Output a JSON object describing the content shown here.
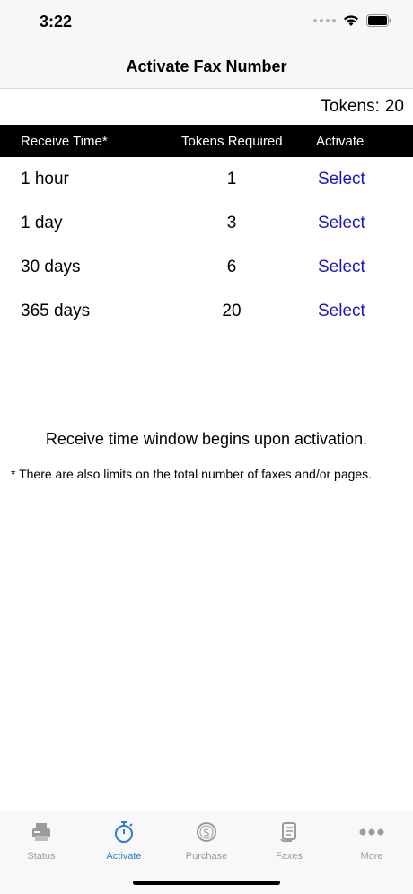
{
  "status_bar": {
    "time": "3:22"
  },
  "nav": {
    "title": "Activate Fax Number"
  },
  "tokens": {
    "label": "Tokens:",
    "value": "20"
  },
  "table": {
    "headers": {
      "receive_time": "Receive Time*",
      "tokens_required": "Tokens Required",
      "activate": "Activate"
    },
    "rows": [
      {
        "time": "1 hour",
        "tokens": "1",
        "action": "Select"
      },
      {
        "time": "1 day",
        "tokens": "3",
        "action": "Select"
      },
      {
        "time": "30 days",
        "tokens": "6",
        "action": "Select"
      },
      {
        "time": "365 days",
        "tokens": "20",
        "action": "Select"
      }
    ]
  },
  "notes": {
    "main": "Receive time window begins upon activation.",
    "footnote": "* There are also limits on the total number of faxes and/or pages."
  },
  "tab_bar": {
    "active_color": "#2a7bd6",
    "inactive_color": "#9b9b9b",
    "tabs": [
      {
        "label": "Status",
        "icon": "fax-machine-icon"
      },
      {
        "label": "Activate",
        "icon": "stopwatch-icon"
      },
      {
        "label": "Purchase",
        "icon": "dollar-coin-icon"
      },
      {
        "label": "Faxes",
        "icon": "document-scroll-icon"
      },
      {
        "label": "More",
        "icon": "more-dots-icon"
      }
    ]
  }
}
